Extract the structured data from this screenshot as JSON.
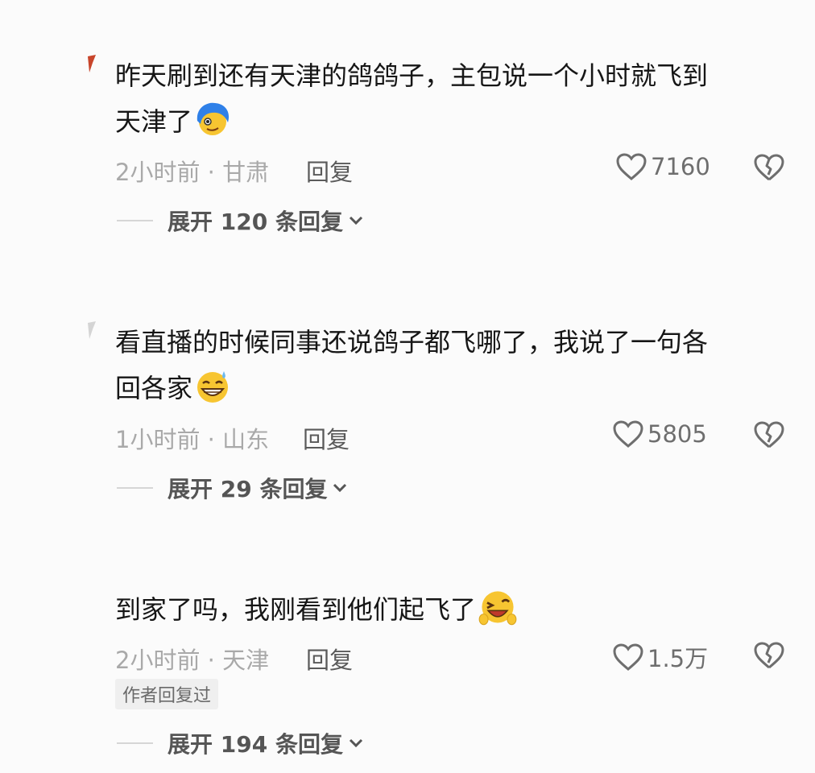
{
  "comments": [
    {
      "lines": [
        "昨天刷到还有天津的鸽鸽子，主包说一个小时就飞到",
        "天津了"
      ],
      "emoji": "blue-hair-face-emoji",
      "time": "2小时前",
      "location": "甘肃",
      "reply_label": "回复",
      "likes": "7160",
      "expand_label": "展开 120 条回复"
    },
    {
      "lines": [
        "看直播的时候同事还说鸽子都飞哪了，我说了一句各",
        "回各家"
      ],
      "emoji": "grin-sweat-emoji",
      "time": "1小时前",
      "location": "山东",
      "reply_label": "回复",
      "likes": "5805",
      "expand_label": "展开 29 条回复"
    },
    {
      "lines": [
        "到家了吗，我刚看到他们起飞了"
      ],
      "emoji": "laughing-wink-emoji",
      "time": "2小时前",
      "location": "天津",
      "reply_label": "回复",
      "likes": "1.5万",
      "author_badge": "作者回复过",
      "expand_label": "展开 194 条回复"
    }
  ],
  "colors": {
    "text": "#161616",
    "meta": "#a9a9a9",
    "emoji_yellow": "#f7c531",
    "emoji_blue": "#2f80e8"
  }
}
